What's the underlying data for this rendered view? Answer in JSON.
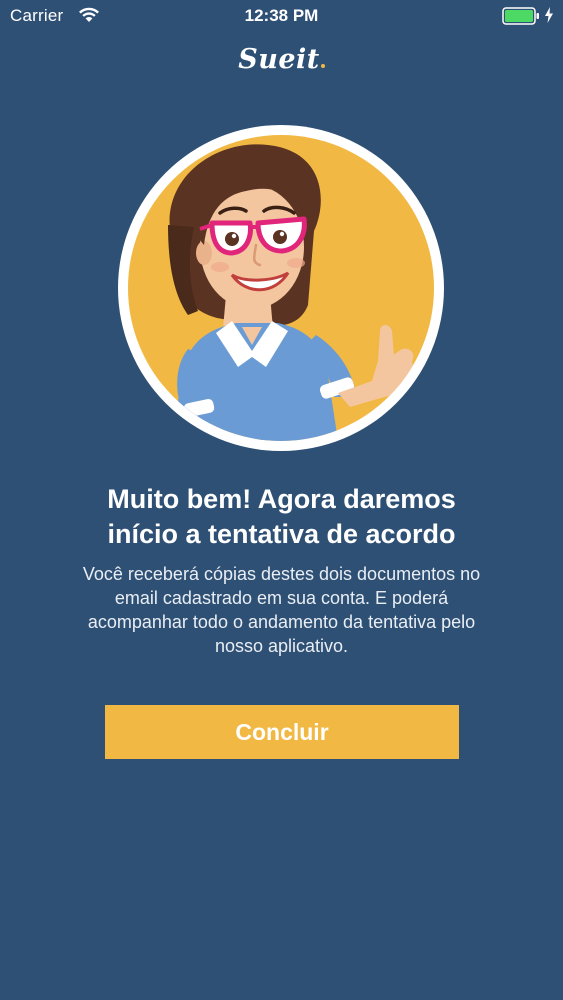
{
  "status_bar": {
    "carrier": "Carrier",
    "time": "12:38 PM",
    "wifi_icon": "wifi-icon",
    "battery_icon": "battery-icon",
    "charging_icon": "bolt-icon"
  },
  "header": {
    "logo": "Sueit"
  },
  "illustration": {
    "icon": "woman-thumbs-up-illustration"
  },
  "content": {
    "headline_line1": "Muito bem! Agora daremos",
    "headline_line2": "início a tentativa de acordo",
    "body_line1": "Você receberá cópias destes dois documentos no",
    "body_line2": "email cadastrado em sua conta. E poderá",
    "body_line3": "acompanhar todo o andamento da tentativa pelo",
    "body_line4": "nosso aplicativo."
  },
  "actions": {
    "primary_label": "Concluir"
  },
  "colors": {
    "background": "#2f5075",
    "accent": "#f1b843",
    "text": "#ffffff",
    "battery": "#4cd964"
  }
}
